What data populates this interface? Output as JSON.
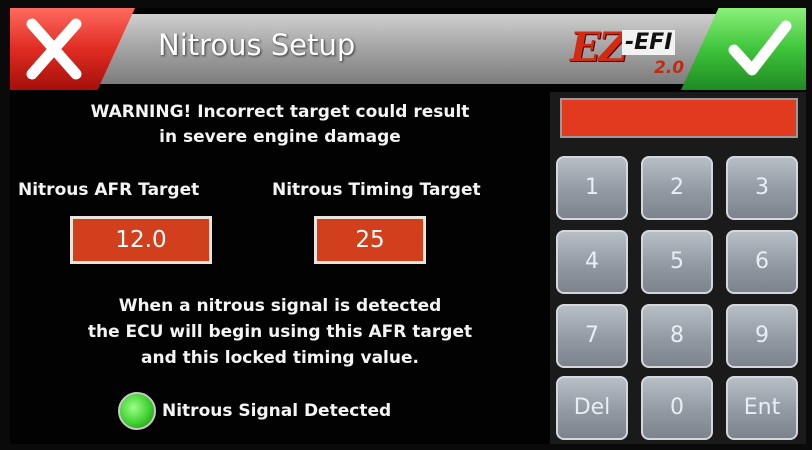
{
  "header": {
    "title": "Nitrous Setup",
    "logo_main": "EZ",
    "logo_tag": "-EFI",
    "logo_version": "2.0"
  },
  "warning": {
    "line1": "WARNING! Incorrect target could result",
    "line2": "in severe engine damage"
  },
  "afr": {
    "label": "Nitrous AFR Target",
    "value": "12.0"
  },
  "timing": {
    "label": "Nitrous Timing Target",
    "value": "25"
  },
  "info": {
    "line1": "When a nitrous signal is detected",
    "line2": "the ECU will begin using this AFR target",
    "line3": "and this locked timing value."
  },
  "signal": {
    "label": "Nitrous Signal Detected",
    "color": "#3fd02f"
  },
  "keypad": {
    "display": "",
    "keys": [
      "1",
      "2",
      "3",
      "4",
      "5",
      "6",
      "7",
      "8",
      "9",
      "Del",
      "0",
      "Ent"
    ]
  },
  "colors": {
    "cancel": "#e02c22",
    "confirm": "#3ec43b",
    "value_box": "#d23f1c"
  }
}
